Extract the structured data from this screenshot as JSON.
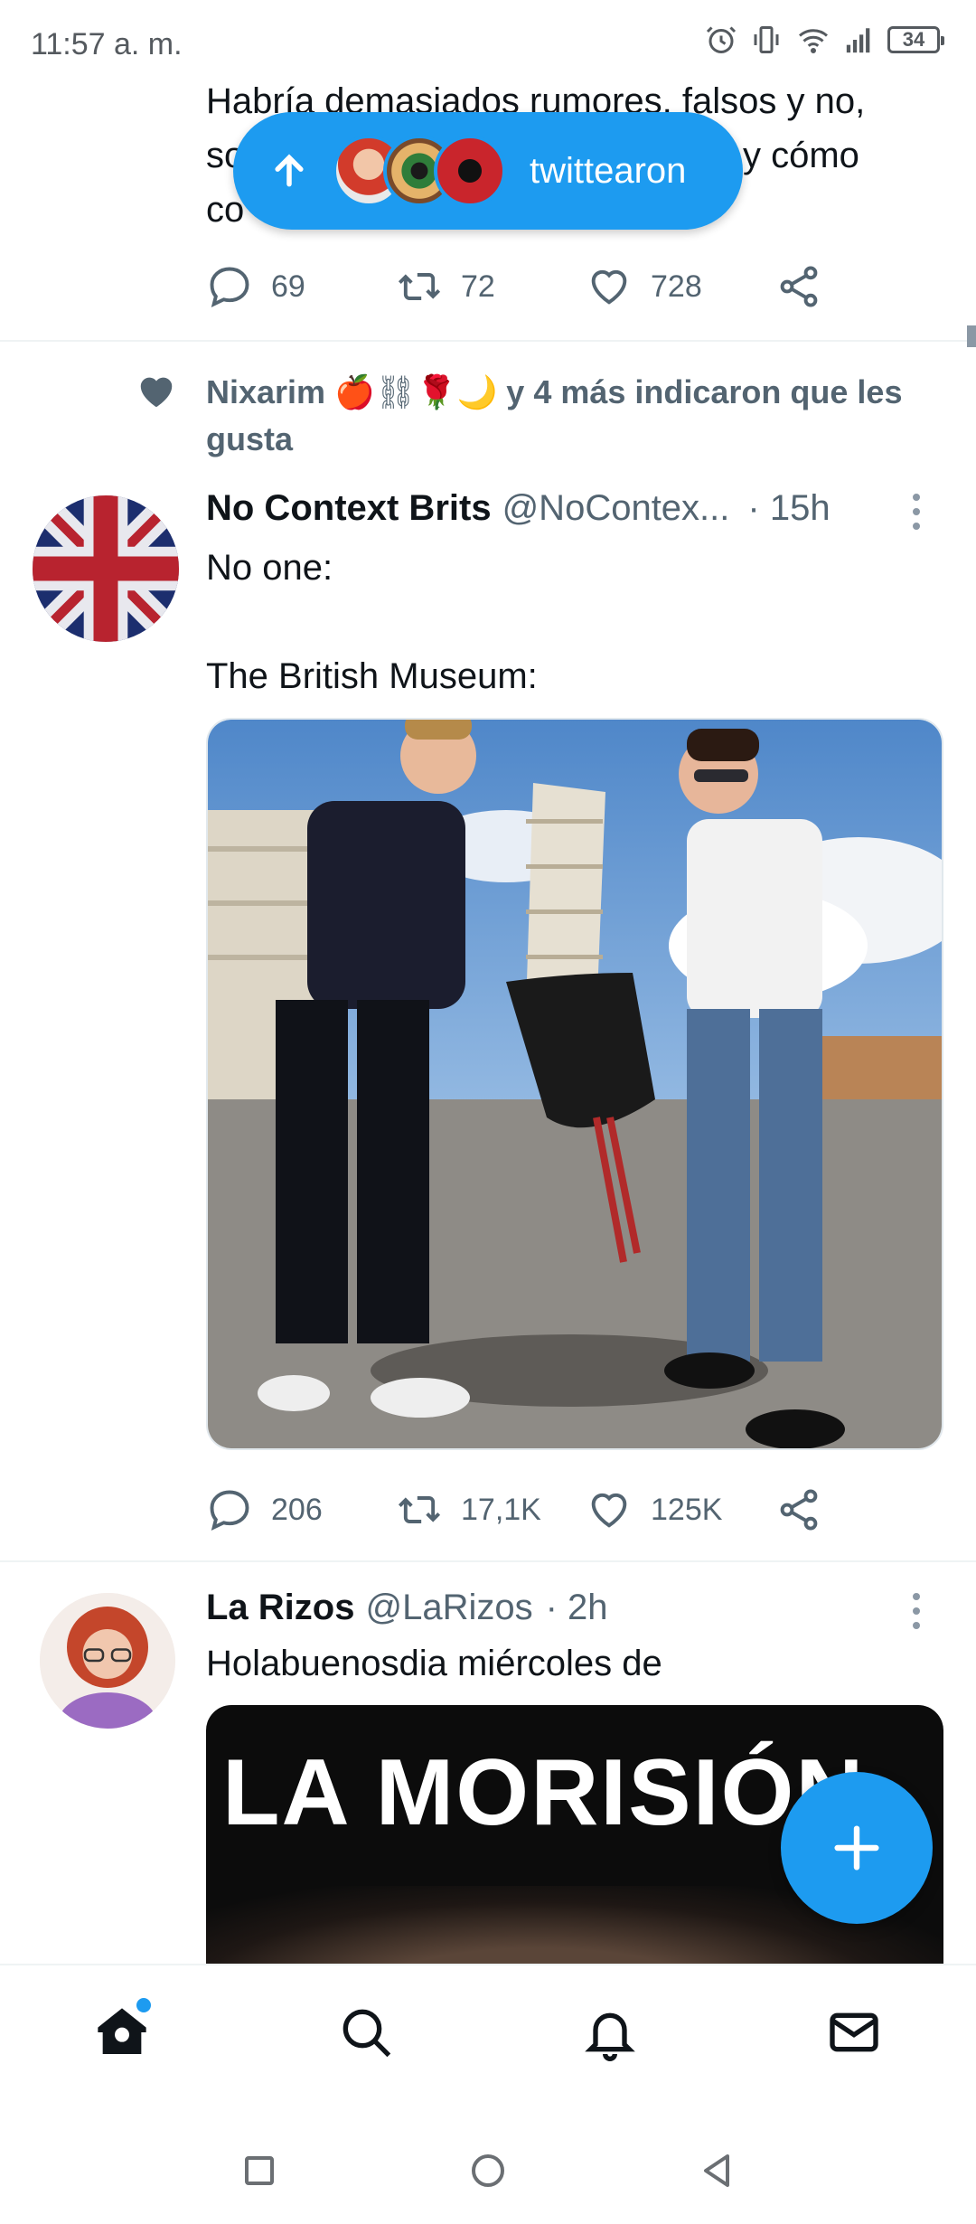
{
  "status_bar": {
    "time": "11:57 a. m.",
    "battery": "34"
  },
  "new_tweets_pill": {
    "label": "twittearon"
  },
  "tweet1": {
    "text_lines": [
      "Habría demasiados rumores, falsos y no,",
      "so",
      "co"
    ],
    "text_right_fragment": "y cómo",
    "replies": "69",
    "retweets": "72",
    "likes": "728"
  },
  "tweet2": {
    "social_context": "y 4 más indicaron que les gusta",
    "social_context_name": "Nixarim",
    "social_context_emojis": "🍎⛓🌹🌙",
    "author_name": "No Context Brits",
    "author_handle": "@NoContex...",
    "time": "· 15h",
    "text_lines": [
      "No one:",
      "",
      "The British Museum:"
    ],
    "replies": "206",
    "retweets": "17,1K",
    "likes": "125K"
  },
  "tweet3": {
    "author_name": "La Rizos",
    "author_handle": "@LaRizos",
    "time": "· 2h",
    "text": "Holabuenosdia miércoles de",
    "media_caption": "LA MORISIÓN"
  },
  "colors": {
    "accent": "#1d9bf0",
    "text": "#0f1419",
    "muted": "#536471"
  }
}
